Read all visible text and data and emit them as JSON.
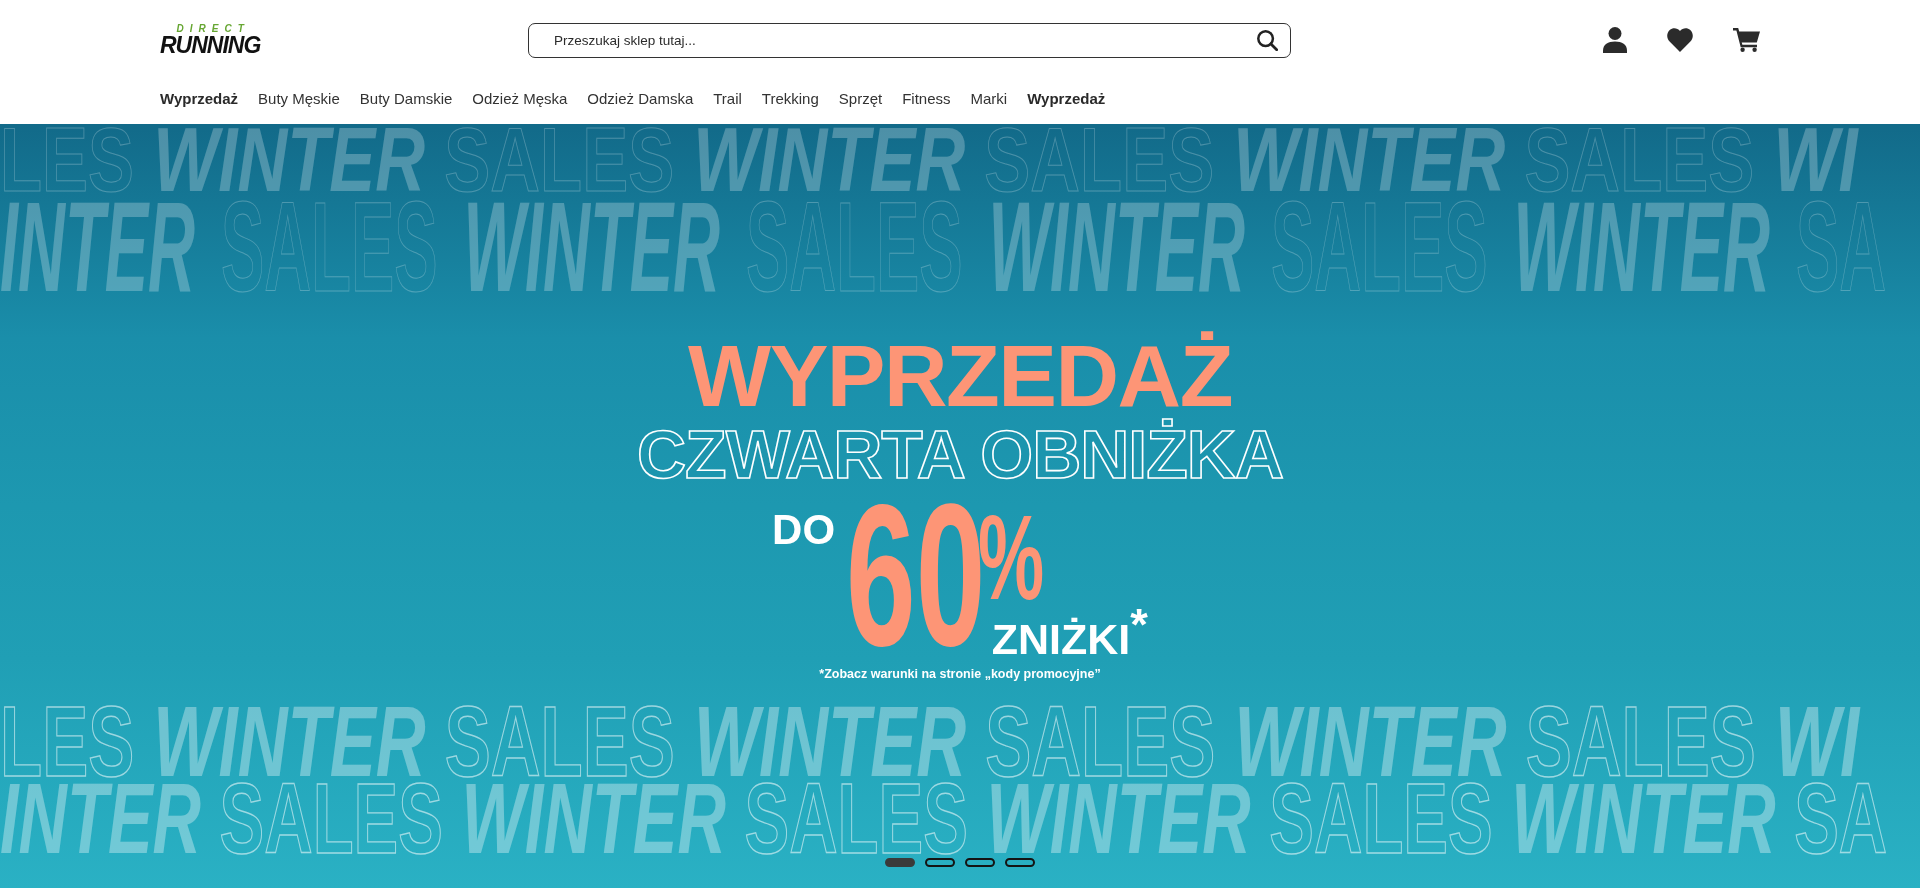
{
  "header": {
    "logo": {
      "tagline": "DIRECT",
      "wordmark": "RUNNING"
    },
    "search": {
      "placeholder": "Przeszukaj sklep tutaj..."
    }
  },
  "nav": [
    {
      "label": "Wyprzedaż",
      "highlighted": true
    },
    {
      "label": "Buty Męskie",
      "highlighted": false
    },
    {
      "label": "Buty Damskie",
      "highlighted": false
    },
    {
      "label": "Odzież Męska",
      "highlighted": false
    },
    {
      "label": "Odzież Damska",
      "highlighted": false
    },
    {
      "label": "Trail",
      "highlighted": false
    },
    {
      "label": "Trekking",
      "highlighted": false
    },
    {
      "label": "Sprzęt",
      "highlighted": false
    },
    {
      "label": "Fitness",
      "highlighted": false
    },
    {
      "label": "Marki",
      "highlighted": false
    },
    {
      "label": "Wyprzedaż",
      "highlighted": true
    }
  ],
  "banner": {
    "pattern_top": [
      "LES **WINTER** SALES **WINTER** SALES **WINTER** SALES **WI**",
      "**INTER** SALES **WINTER** SALES **WINTER** SALES **WINTER** SA"
    ],
    "headline": "WYPRZEDAŻ",
    "subheadline": "CZWARTA OBNIŻKA",
    "prefix": "DO",
    "amount": "60",
    "unit": "%",
    "suffix": "ZNIŻKI$^{*}$",
    "footnote": "*Zobacz warunki na stronie „kody promocyjne”",
    "pattern_bottom": [
      "LES **WINTER** SALES **WINTER** SALES **WINTER** SALES **WI**",
      "**INTER** SALES **WINTER** SALES **WINTER** SALES **WINTER** SA"
    ]
  },
  "carousel": {
    "dots": [
      {
        "selected": true
      },
      {
        "selected": false
      },
      {
        "selected": false
      },
      {
        "selected": false
      }
    ]
  }
}
